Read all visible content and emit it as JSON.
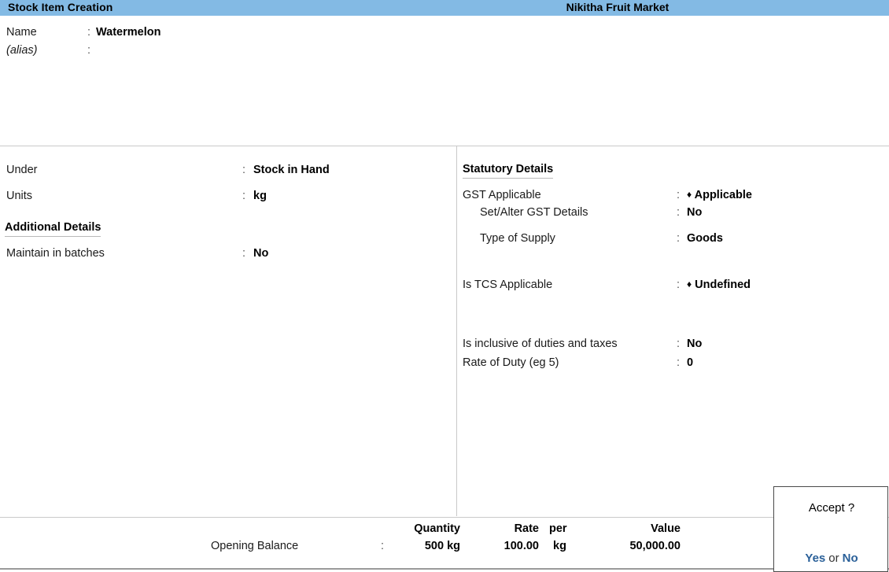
{
  "titlebar": {
    "screen_title": "Stock Item Creation",
    "company_title": "Nikitha Fruit Market",
    "bg_color": "#83bae4"
  },
  "identity": {
    "name_label": "Name",
    "name_value": "Watermelon",
    "alias_label": "(alias)",
    "alias_value": "",
    "separator": ":"
  },
  "left_panel": {
    "rows": [
      {
        "label": "Under",
        "separator": ":",
        "value": "Stock in Hand"
      },
      {
        "label": "Units",
        "separator": ":",
        "value": "kg"
      }
    ],
    "additional_details_heading": "Additional Details",
    "additional_rows": [
      {
        "label": "Maintain in batches",
        "separator": ":",
        "value": "No"
      }
    ]
  },
  "right_panel": {
    "statutory_heading": "Statutory Details",
    "rows": [
      {
        "label": "GST Applicable",
        "separator": ":",
        "bullet": "♦",
        "value": "Applicable"
      },
      {
        "label": "Set/Alter GST Details",
        "separator": ":",
        "bullet": "",
        "value": "No"
      },
      {
        "label": "Type of Supply",
        "separator": ":",
        "bullet": "",
        "value": "Goods"
      },
      {
        "label": "Is TCS Applicable",
        "separator": ":",
        "bullet": "♦",
        "value": "Undefined"
      },
      {
        "label": "Is inclusive of duties and taxes",
        "separator": ":",
        "bullet": "",
        "value": "No"
      },
      {
        "label": "Rate of Duty (eg 5)",
        "separator": ":",
        "bullet": "",
        "value": "0"
      }
    ]
  },
  "opening_balance": {
    "row_label": "Opening Balance",
    "separator": ":",
    "headers": {
      "quantity": "Quantity",
      "rate": "Rate",
      "per": "per",
      "value": "Value"
    },
    "values": {
      "quantity": "500 kg",
      "rate": "100.00",
      "per": "kg",
      "value": "50,000.00"
    }
  },
  "accept_dialog": {
    "title": "Accept ?",
    "yes_label": "Yes",
    "or_label": "or",
    "no_label": "No",
    "link_color": "#2a6099"
  }
}
